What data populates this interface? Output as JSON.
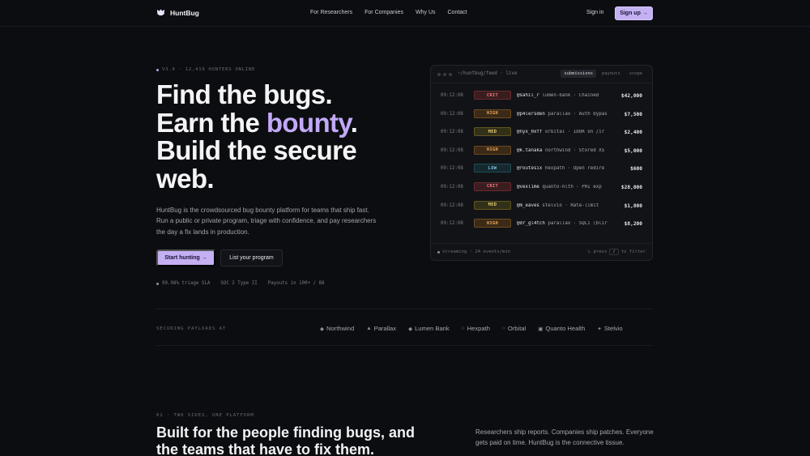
{
  "nav": {
    "brand": "HuntBug",
    "links": [
      "For Researchers",
      "For Companies",
      "Why Us",
      "Contact"
    ],
    "signin": "Sign in",
    "signup": "Sign up →"
  },
  "hero": {
    "meta": "V3.4 · 12,419 HUNTERS ONLINE",
    "line1": "Find the bugs.",
    "line2a": "Earn the ",
    "line2b": "bounty",
    "line2c": ".",
    "line3": "Build the secure",
    "line4": "web.",
    "lede": "HuntBug is the crowdsourced bug bounty platform for teams that ship fast. Run a public or private program, triage with confidence, and pay researchers the day a fix lands in production.",
    "cta_primary": "Start hunting →",
    "cta_secondary": "List your program",
    "stats": [
      "99.98% triage SLA",
      "SOC 2 Type II",
      "Payouts in 100+ / 88"
    ]
  },
  "feed": {
    "path": "~/huntbug/feed · live",
    "tabs": [
      "submissions",
      "payouts",
      "scope"
    ],
    "active_tab": "submissions",
    "rows": [
      {
        "time": "09:12:08",
        "severity": "CRIT",
        "handle": "@sahil_r",
        "desc": "lumen-bank · Chained",
        "amount": "$42,000"
      },
      {
        "time": "09:12:08",
        "severity": "HIGH",
        "handle": "@p4lersden",
        "desc": "parallax · Auth bypas",
        "amount": "$7,500"
      },
      {
        "time": "09:12:08",
        "severity": "MED",
        "handle": "@nyx_0xff",
        "desc": "orbital · IDOR on /ir",
        "amount": "$2,400"
      },
      {
        "time": "09:12:08",
        "severity": "HIGH",
        "handle": "@k.tanaka",
        "desc": "northwind · Stored XS",
        "amount": "$5,000"
      },
      {
        "time": "09:12:08",
        "severity": "LOW",
        "handle": "@routesix",
        "desc": "hexpath · Open redire",
        "amount": "$600"
      },
      {
        "time": "09:12:08",
        "severity": "CRIT",
        "handle": "@vexlime",
        "desc": "quanto-hlth · PHI exp",
        "amount": "$28,000"
      },
      {
        "time": "09:12:08",
        "severity": "MED",
        "handle": "@m_eaves",
        "desc": "stelvio · Rate-limit",
        "amount": "$1,800"
      },
      {
        "time": "09:12:08",
        "severity": "HIGH",
        "handle": "@dr_gl4tch",
        "desc": "parallax · SQLi (blir",
        "amount": "$8,200"
      }
    ],
    "footer_left": "streaming · 24 events/min",
    "footer_press": "↳ press",
    "footer_key": "/",
    "footer_right": "to filter"
  },
  "severity_colors": {
    "CRIT": {
      "bg": "#3a1d1f",
      "border": "#6b2a2f",
      "text": "#f07a80"
    },
    "HIGH": {
      "bg": "#3a2a17",
      "border": "#6e4a1f",
      "text": "#f2a65a"
    },
    "MED": {
      "bg": "#33301a",
      "border": "#5f561f",
      "text": "#e3cf6e"
    },
    "LOW": {
      "bg": "#16292f",
      "border": "#1f4c58",
      "text": "#79c6dc"
    }
  },
  "logos": {
    "label": "SECURING PAYLOADS AT",
    "items": [
      {
        "glyph": "◆",
        "name": "Northwind"
      },
      {
        "glyph": "▲",
        "name": "Parallax"
      },
      {
        "glyph": "◆",
        "name": "Lumen Bank"
      },
      {
        "glyph": "○",
        "name": "Hexpath"
      },
      {
        "glyph": "○",
        "name": "Orbital"
      },
      {
        "glyph": "▣",
        "name": "Quanto Health"
      },
      {
        "glyph": "✦",
        "name": "Stelvio"
      }
    ]
  },
  "section": {
    "label": "01 · TWO SIDES, ONE PLATFORM",
    "title": "Built for the people finding bugs, and the teams that have to fix them.",
    "copy": "Researchers ship reports. Companies ship patches. Everyone gets paid on time. HuntBug is the connective tissue."
  }
}
